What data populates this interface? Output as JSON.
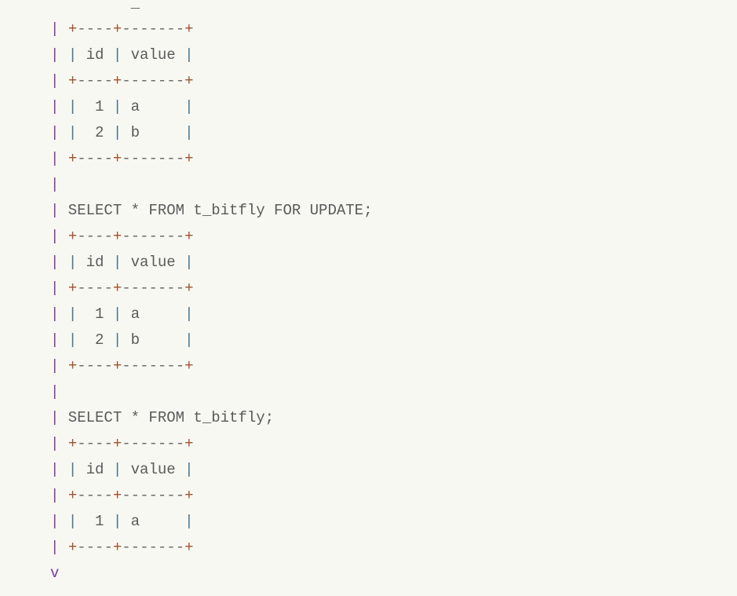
{
  "code_lines": [
    "         _",
    "| +----+-------+",
    "| | id | value |",
    "| +----+-------+",
    "| |  1 | a     |",
    "| |  2 | b     |",
    "| +----+-------+",
    "|",
    "| SELECT * FROM t_bitfly FOR UPDATE;",
    "| +----+-------+",
    "| | id | value |",
    "| +----+-------+",
    "| |  1 | a     |",
    "| |  2 | b     |",
    "| +----+-------+",
    "|",
    "| SELECT * FROM t_bitfly;",
    "| +----+-------+",
    "| | id | value |",
    "| +----+-------+",
    "| |  1 | a     |",
    "| +----+-------+",
    "v"
  ],
  "colors": {
    "background": "#f8f8f2",
    "lead_pipe": "#7a3e9d",
    "plus": "#a0522d",
    "text": "#5a5a5a"
  }
}
